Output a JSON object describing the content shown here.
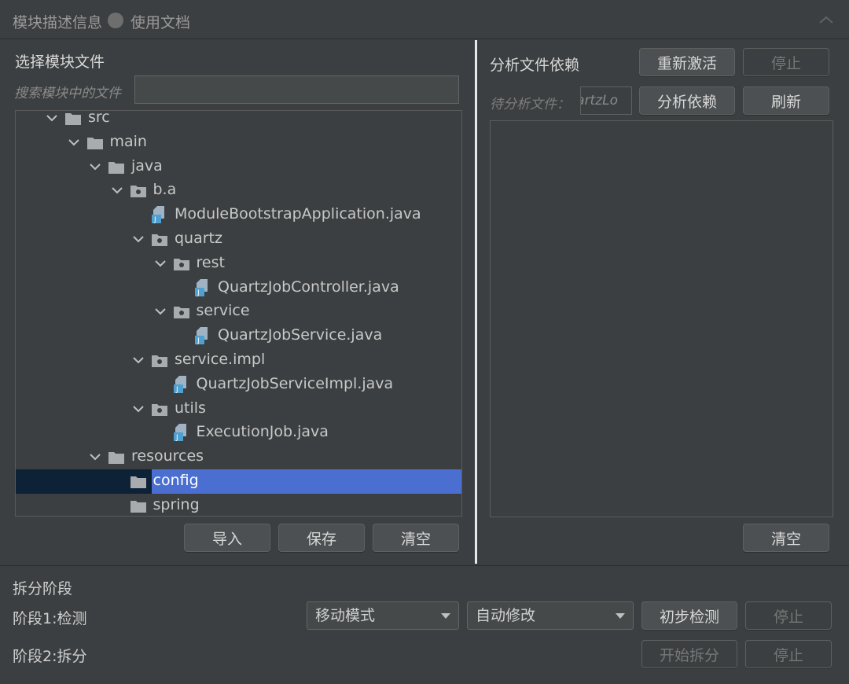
{
  "header": {
    "title": "模块描述信息",
    "link": "使用文档"
  },
  "left": {
    "title": "选择模块文件",
    "search_label": "搜索模块中的文件",
    "search_value": "",
    "tree": [
      {
        "label": "src",
        "type": "folder",
        "expanded": true
      },
      {
        "label": "main",
        "type": "folder",
        "expanded": true
      },
      {
        "label": "java",
        "type": "folder",
        "expanded": true
      },
      {
        "label": "b.a",
        "type": "package",
        "expanded": true
      },
      {
        "label": "ModuleBootstrapApplication.java",
        "type": "java"
      },
      {
        "label": "quartz",
        "type": "package",
        "expanded": true
      },
      {
        "label": "rest",
        "type": "package",
        "expanded": true
      },
      {
        "label": "QuartzJobController.java",
        "type": "java"
      },
      {
        "label": "service",
        "type": "package",
        "expanded": true
      },
      {
        "label": "QuartzJobService.java",
        "type": "java"
      },
      {
        "label": "service.impl",
        "type": "package",
        "expanded": true
      },
      {
        "label": "QuartzJobServiceImpl.java",
        "type": "java"
      },
      {
        "label": "utils",
        "type": "package",
        "expanded": true
      },
      {
        "label": "ExecutionJob.java",
        "type": "java"
      },
      {
        "label": "resources",
        "type": "folder",
        "expanded": true
      },
      {
        "label": "config",
        "type": "folder",
        "selected": true
      },
      {
        "label": "spring",
        "type": "folder"
      }
    ],
    "buttons": {
      "import": "导入",
      "save": "保存",
      "clear": "清空"
    }
  },
  "right": {
    "title": "分析文件依赖",
    "reactivate": "重新激活",
    "stop": "停止",
    "pending_label": "待分析文件：",
    "pending_value": "QuartzLo",
    "analyze": "分析依赖",
    "refresh": "刷新",
    "clear": "清空"
  },
  "bottom": {
    "title": "拆分阶段",
    "phase1": {
      "label": "阶段1:检测",
      "mode": "移动模式",
      "fix": "自动修改",
      "detect": "初步检测",
      "stop": "停止"
    },
    "phase2": {
      "label": "阶段2:拆分",
      "start": "开始拆分",
      "stop": "停止"
    }
  },
  "colors": {
    "background": "#3c3f41",
    "selection": "#4a6fd1",
    "selection_row": "#0d2137",
    "java_icon": "#4f9fcf"
  }
}
